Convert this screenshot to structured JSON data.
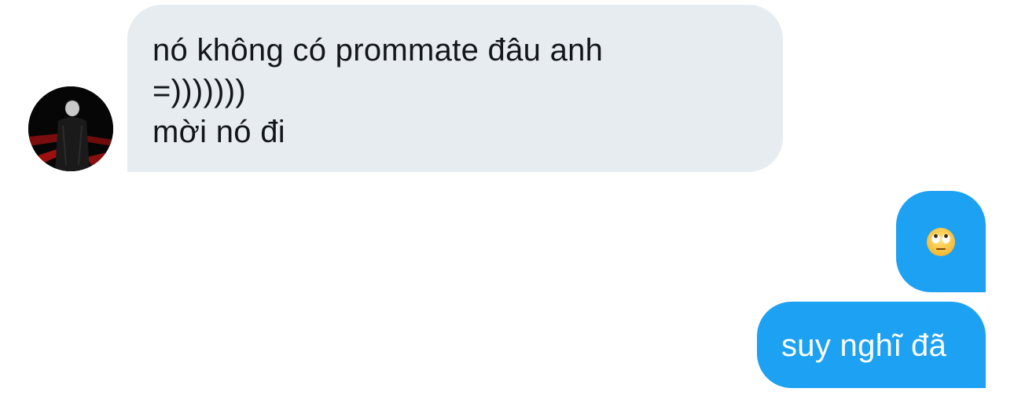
{
  "conversation": {
    "incoming": {
      "avatar_icon": "user-avatar-photo",
      "lines": [
        "nó không có prommate đâu anh",
        "=)))))))",
        "mời nó đi"
      ]
    },
    "outgoing": [
      {
        "type": "emoji",
        "emoji_icon": "face-with-rolling-eyes-icon"
      },
      {
        "type": "text",
        "text": "suy nghĩ đã"
      }
    ]
  },
  "colors": {
    "incoming_bubble": "#e6ecf0",
    "incoming_text": "#14171a",
    "outgoing_bubble": "#1da1f2",
    "outgoing_text": "#ffffff"
  }
}
